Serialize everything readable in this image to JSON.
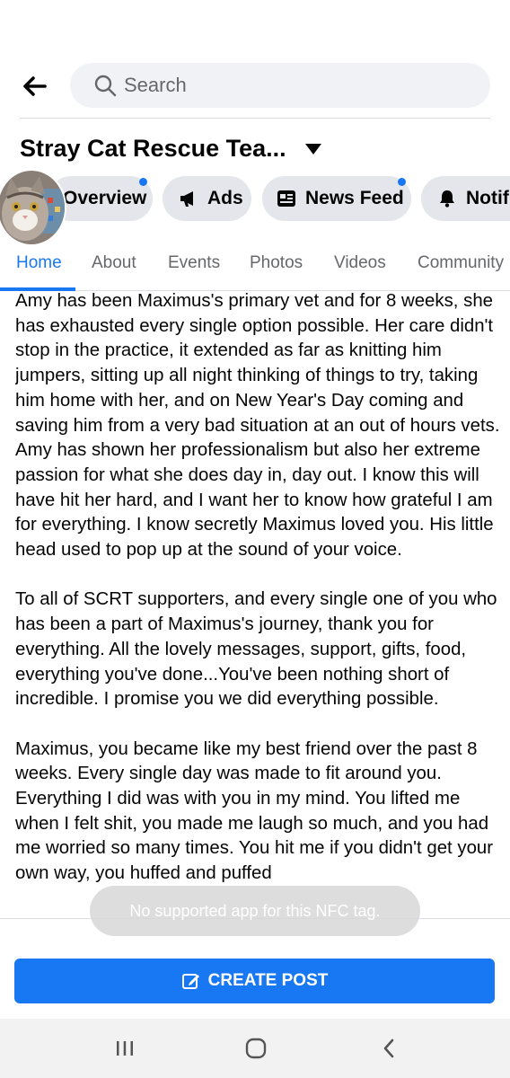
{
  "search": {
    "placeholder": "Search"
  },
  "page": {
    "title": "Stray Cat Rescue Tea..."
  },
  "pills": [
    {
      "label": "Overview",
      "icon": "overview-icon",
      "badge": true
    },
    {
      "label": "Ads",
      "icon": "megaphone-icon",
      "badge": false
    },
    {
      "label": "News Feed",
      "icon": "news-feed-icon",
      "badge": true
    },
    {
      "label": "Notifi",
      "icon": "bell-icon",
      "badge": false
    }
  ],
  "tabs": [
    {
      "label": "Home",
      "active": true
    },
    {
      "label": "About",
      "active": false
    },
    {
      "label": "Events",
      "active": false
    },
    {
      "label": "Photos",
      "active": false
    },
    {
      "label": "Videos",
      "active": false
    },
    {
      "label": "Community",
      "active": false
    }
  ],
  "post": {
    "paragraphs": [
      "Amy has been Maximus's primary vet and for 8 weeks, she has exhausted every single option possible. Her care didn't stop in the practice, it extended as far as knitting him jumpers, sitting up all night thinking of things to try, taking him home with her, and on New Year's Day coming and saving him from a very bad situation at an out of hours vets. Amy has shown her professionalism but also her extreme passion for what she does day in, day out. I know this will have hit her hard, and I want her to know how grateful I am for everything. I know secretly Maximus loved you. His little head used to pop up at the sound of your voice.",
      "To all of SCRT supporters, and every single one of you who has been a part of Maximus's journey, thank you for everything. All the lovely messages, support, gifts, food, everything you've done...You've been nothing short of incredible. I promise you we did everything possible.",
      "Maximus, you became like my best friend over the past 8 weeks. Every single day was made to fit around you. Everything I did was with you in my mind. You lifted me when I felt shit, you made me laugh so much, and you had me worried so many times. You hit me if you didn't get your own way, you huffed and puffed"
    ]
  },
  "toast": {
    "text": "No supported app for this NFC tag."
  },
  "create_post": {
    "label": "CREATE POST"
  },
  "colors": {
    "accent": "#1877f2",
    "pill_bg": "#e4e6eb",
    "search_bg": "#f0f2f5"
  }
}
